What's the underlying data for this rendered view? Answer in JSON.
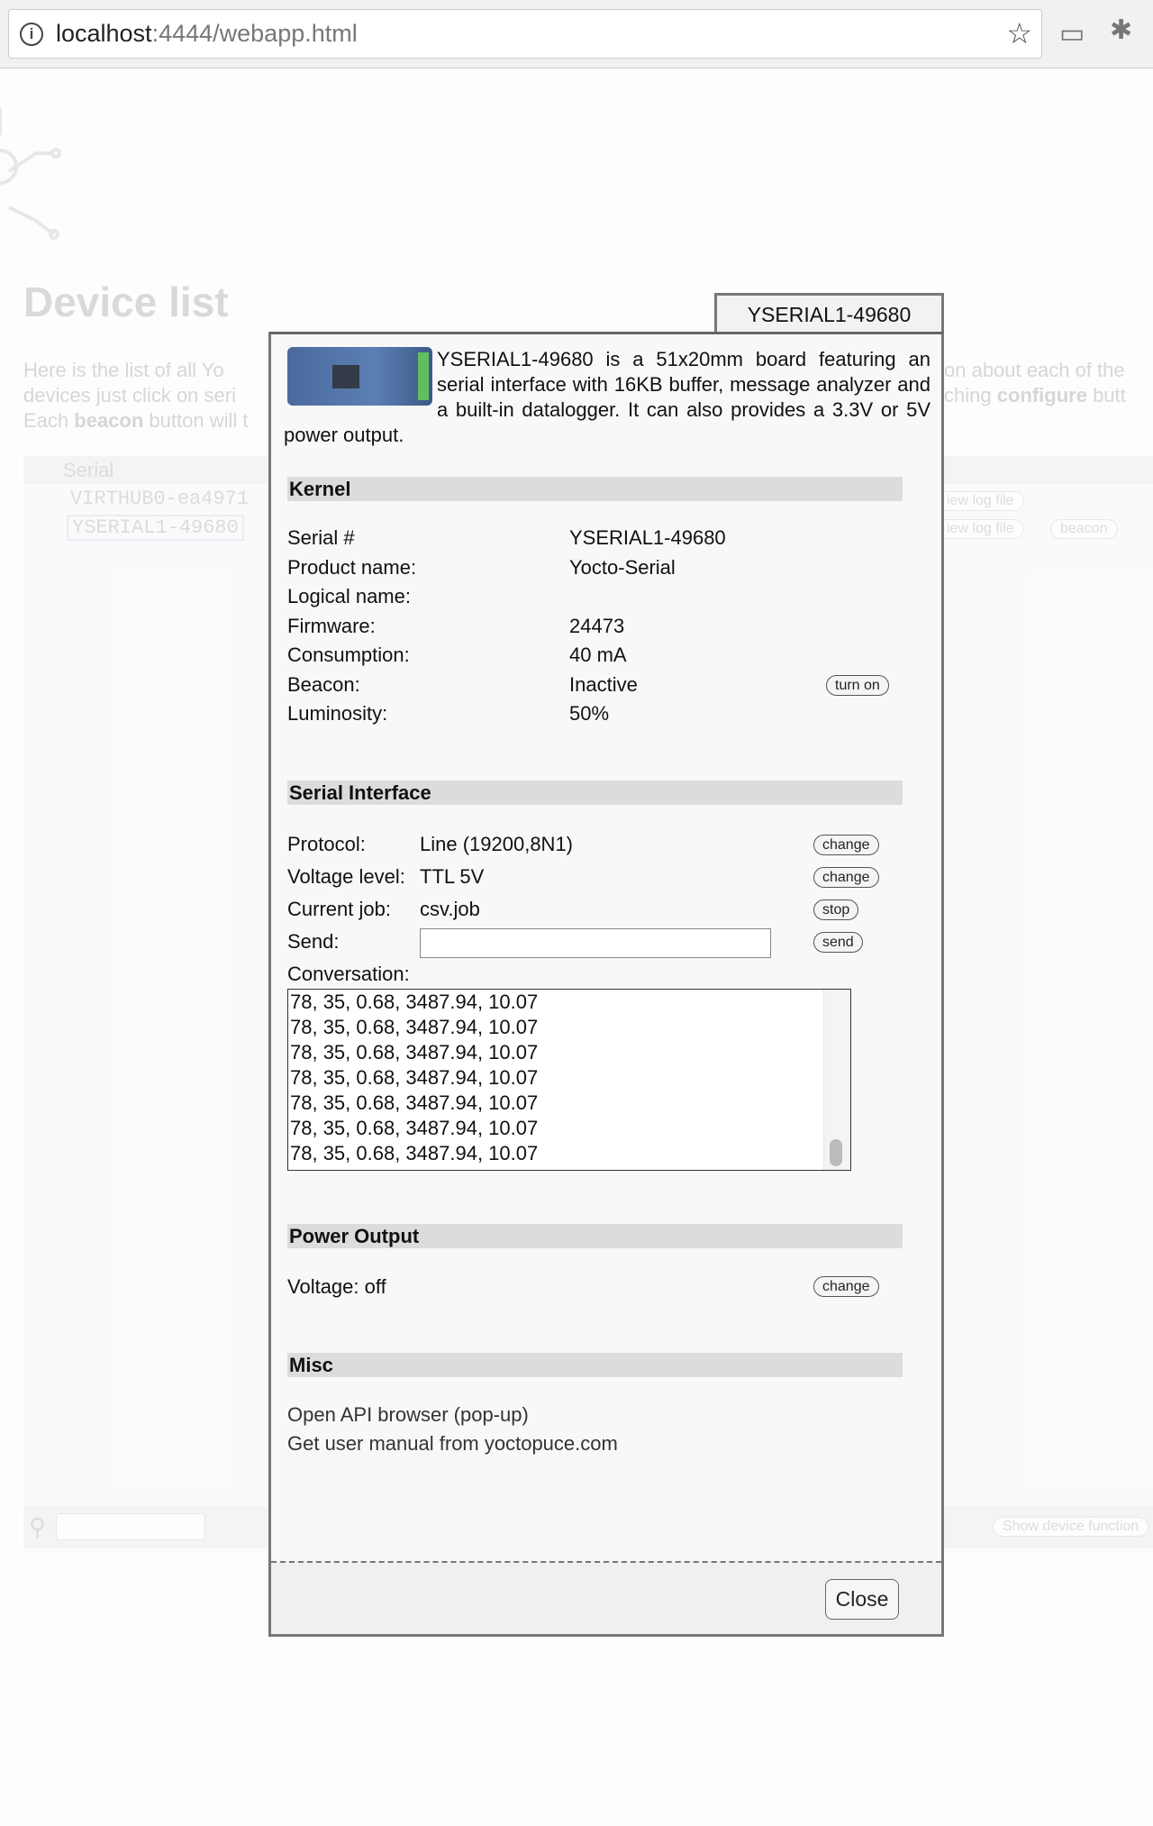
{
  "browser": {
    "url_host": "localhost",
    "url_rest": ":4444/webapp.html",
    "icons": [
      "info-icon",
      "star-icon",
      "cast-icon",
      "extension-icon"
    ]
  },
  "background": {
    "title": "Device list",
    "intro_line1_a": "Here is the list of all Yo",
    "intro_line1_b": "on about each of the",
    "intro_line2_a": "devices just click on seri",
    "intro_line2_b": "ching ",
    "intro_line2_bold": "configure",
    "intro_line2_c": " butt",
    "intro_line3_a": "Each ",
    "intro_line3_bold": "beacon",
    "intro_line3_b": " button will t",
    "table_header": "Serial",
    "rows": [
      {
        "serial": "VIRTHUB0-ea4971",
        "action": "iew log file"
      },
      {
        "serial": "YSERIAL1-49680",
        "action": "iew log file",
        "beacon": "beacon"
      }
    ],
    "show_functions": "Show device function"
  },
  "dialog": {
    "tab_title": "YSERIAL1-49680",
    "description": "YSERIAL1-49680 is a 51x20mm board featuring an serial interface with 16KB buffer, message analyzer and a built-in datalogger. It can also provides a 3.3V or 5V power output.",
    "kernel": {
      "title": "Kernel",
      "rows": [
        {
          "label": "Serial #",
          "value": "YSERIAL1-49680"
        },
        {
          "label": "Product name:",
          "value": "Yocto-Serial"
        },
        {
          "label": "Logical name:",
          "value": ""
        },
        {
          "label": "Firmware:",
          "value": "24473"
        },
        {
          "label": "Consumption:",
          "value": "40 mA"
        },
        {
          "label": "Beacon:",
          "value": "Inactive",
          "button": "turn on"
        },
        {
          "label": "Luminosity:",
          "value": "50%"
        }
      ]
    },
    "serial": {
      "title": "Serial Interface",
      "rows": [
        {
          "label": "Protocol:",
          "value": "Line (19200,8N1)",
          "button": "change"
        },
        {
          "label": "Voltage level:",
          "value": "TTL 5V",
          "button": "change"
        },
        {
          "label": "Current job:",
          "value": "csv.job",
          "button": "stop"
        },
        {
          "label": "Send:",
          "value": "",
          "button": "send"
        }
      ],
      "conversation_label": "Conversation:",
      "conversation": [
        "78, 35, 0.68, 3487.94, 10.07",
        "78, 35, 0.68, 3487.94, 10.07",
        "78, 35, 0.68, 3487.94, 10.07",
        "78, 35, 0.68, 3487.94, 10.07",
        "78, 35, 0.68, 3487.94, 10.07",
        "78, 35, 0.68, 3487.94, 10.07",
        "78, 35, 0.68, 3487.94, 10.07"
      ]
    },
    "power": {
      "title": "Power Output",
      "voltage": "Voltage: off",
      "button": "change"
    },
    "misc": {
      "title": "Misc",
      "links": [
        "Open API browser (pop-up)",
        "Get user manual from yoctopuce.com"
      ]
    },
    "close_label": "Close"
  }
}
